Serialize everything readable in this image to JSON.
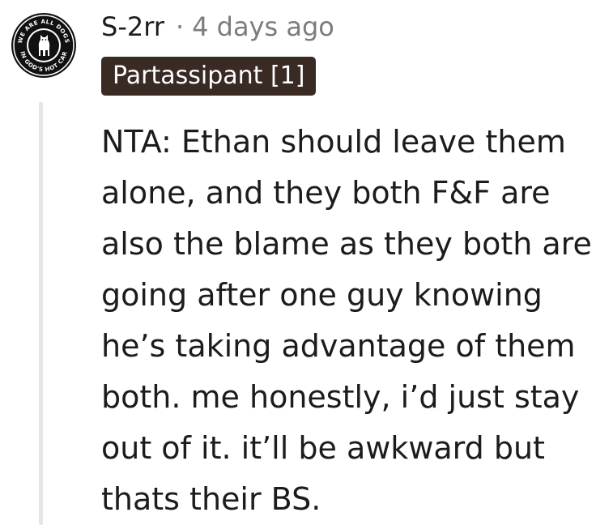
{
  "comment": {
    "author": "S-2rr",
    "separator": "·",
    "timestamp": "4 days ago",
    "flair": "Partassipant [1]",
    "body": "NTA: Ethan should leave them alone, and they both F&F are also the blame as they both are going after one guy knowing he’s taking advantage of them both. me honestly, i’d just stay out of it. it’ll be awkward but thats their BS.",
    "avatar": {
      "icon": "dog-badge-icon",
      "ring_text_top": "WE ARE ALL DOGS",
      "ring_text_bottom": "IN GOD'S HOT CAR"
    }
  },
  "colors": {
    "text": "#1c1c1c",
    "meta": "#7c7c7c",
    "flair_bg": "#3a2a24",
    "flair_text": "#ffffff",
    "thread_line": "#e6e6e6"
  }
}
